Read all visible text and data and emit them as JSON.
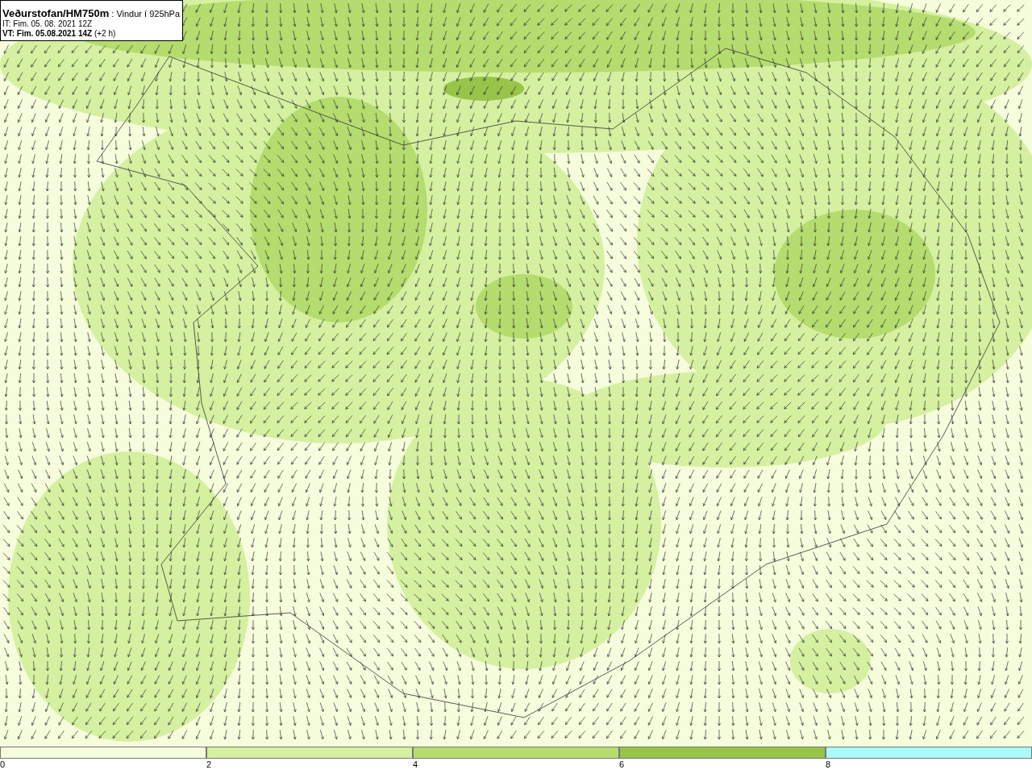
{
  "title_box": {
    "source": "Veðurstofan/HM750m",
    "field": ": Vindur í 925hPa",
    "init_time": "IT: Fim. 05. 08. 2021 12Z",
    "valid_time": "VT: Fim. 05.08.2021 14Z",
    "valid_offset": "(+2 h)"
  },
  "legend": {
    "bins": [
      {
        "label": "0",
        "color": "#f5fddc"
      },
      {
        "label": "2",
        "color": "#d5f0a0"
      },
      {
        "label": "4",
        "color": "#b4dc6e"
      },
      {
        "label": "6",
        "color": "#98c44a"
      },
      {
        "label": "8",
        "color": "#aafcfc"
      }
    ]
  }
}
